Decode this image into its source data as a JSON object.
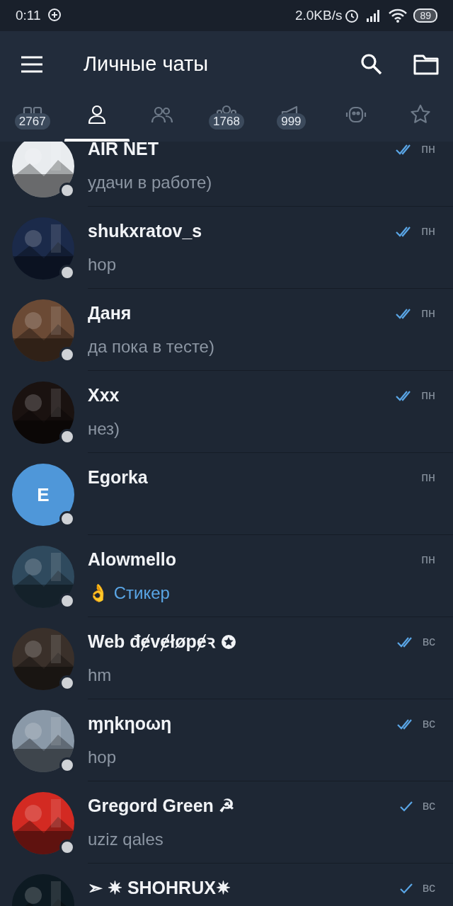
{
  "status_bar": {
    "time": "0:11",
    "speed": "2.0KB/s",
    "battery": "89"
  },
  "header": {
    "title": "Личные чаты"
  },
  "tabs": [
    {
      "badge": "2767",
      "selected": false
    },
    {
      "selected": true
    },
    {
      "selected": false
    },
    {
      "badge": "1768",
      "selected": false
    },
    {
      "badge": "999",
      "selected": false
    },
    {
      "selected": false
    },
    {
      "selected": false
    }
  ],
  "chats": [
    {
      "kind": "picture",
      "name": "AIR NET",
      "preview": "удачи в работе)",
      "media": false,
      "time": "пн",
      "outgoing": true,
      "read": true
    },
    {
      "kind": "picture",
      "name": "shukxratov_s",
      "preview": "hop",
      "media": false,
      "time": "пн",
      "outgoing": true,
      "read": true
    },
    {
      "kind": "picture",
      "name": "Даня",
      "preview": "да пока в тесте)",
      "media": false,
      "time": "пн",
      "outgoing": true,
      "read": true
    },
    {
      "kind": "picture",
      "name": "Xxx",
      "preview": "нез)",
      "media": false,
      "time": "пн",
      "outgoing": true,
      "read": true
    },
    {
      "kind": "letter",
      "letter": "E",
      "name": "Egorka",
      "time": "пн",
      "outgoing": false
    },
    {
      "kind": "picture",
      "name": "Alowmello",
      "preview": "👌 Стикер",
      "media": true,
      "time": "пн",
      "outgoing": false
    },
    {
      "kind": "picture",
      "name": "Web đɇvɇłøpɇꝛ",
      "star": true,
      "preview": "hm",
      "media": false,
      "time": "вс",
      "outgoing": true,
      "read": true
    },
    {
      "kind": "picture",
      "name": "ɱηkηοωη",
      "preview": "hop",
      "media": false,
      "time": "вс",
      "outgoing": true,
      "read": true
    },
    {
      "kind": "picture",
      "name": "Gregord Green ☭",
      "preview": "uziz qales",
      "media": false,
      "time": "вс",
      "outgoing": true,
      "read": false
    },
    {
      "kind": "picture",
      "name": "➣ ✷ SHOHRUX✷",
      "time": "вс",
      "outgoing": true,
      "read": false
    }
  ]
}
